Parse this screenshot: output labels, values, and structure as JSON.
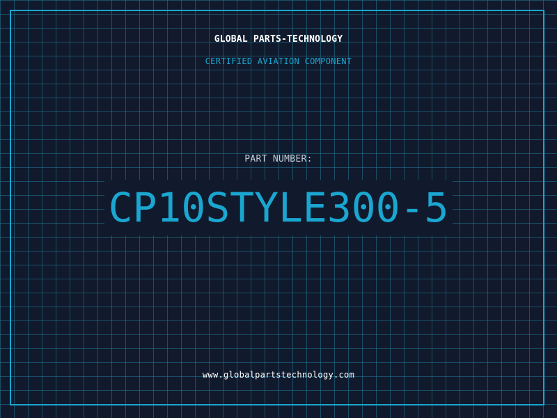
{
  "header": {
    "brand": "GLOBAL PARTS-TECHNOLOGY",
    "subtitle": "CERTIFIED AVIATION COMPONENT"
  },
  "part": {
    "label": "PART NUMBER:",
    "number": "CP10STYLE300-5"
  },
  "footer": {
    "website": "www.globalpartstechnology.com"
  },
  "colors": {
    "background": "#111a2c",
    "grid": "#20788f",
    "accent": "#1aa6d1",
    "text": "#ffffff",
    "label": "#c4ccd6"
  }
}
